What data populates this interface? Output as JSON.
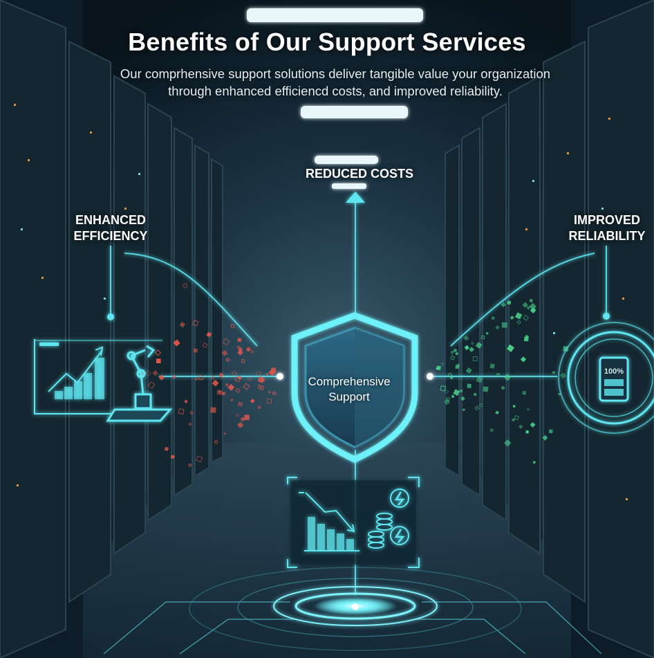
{
  "header": {
    "title": "Benefits of Our Support Services",
    "subtitle": "Our comprhensive support solutions deliver tangible value your organization through enhanced efficiencd costs, and improved reliability."
  },
  "benefits": {
    "reduced_costs": "REDUCED COSTS",
    "enhanced_efficiency": "ENHANCED\nEFFICIENCY",
    "improved_reliability": "IMPROVED\nRELIABILITY"
  },
  "center": {
    "label": "Comprehensive\nSupport"
  },
  "reliability_panel": {
    "battery_text": "100%"
  },
  "icons": [
    "shield-icon",
    "growth-chart-icon",
    "robotic-arm-icon",
    "cost-down-chart-icon",
    "coin-stack-icon",
    "lightning-icon",
    "battery-icon"
  ],
  "colors": {
    "accent": "#5ee6f0",
    "particle_red": "#e2574c",
    "particle_green": "#48d08a",
    "background": "#0b1822"
  }
}
